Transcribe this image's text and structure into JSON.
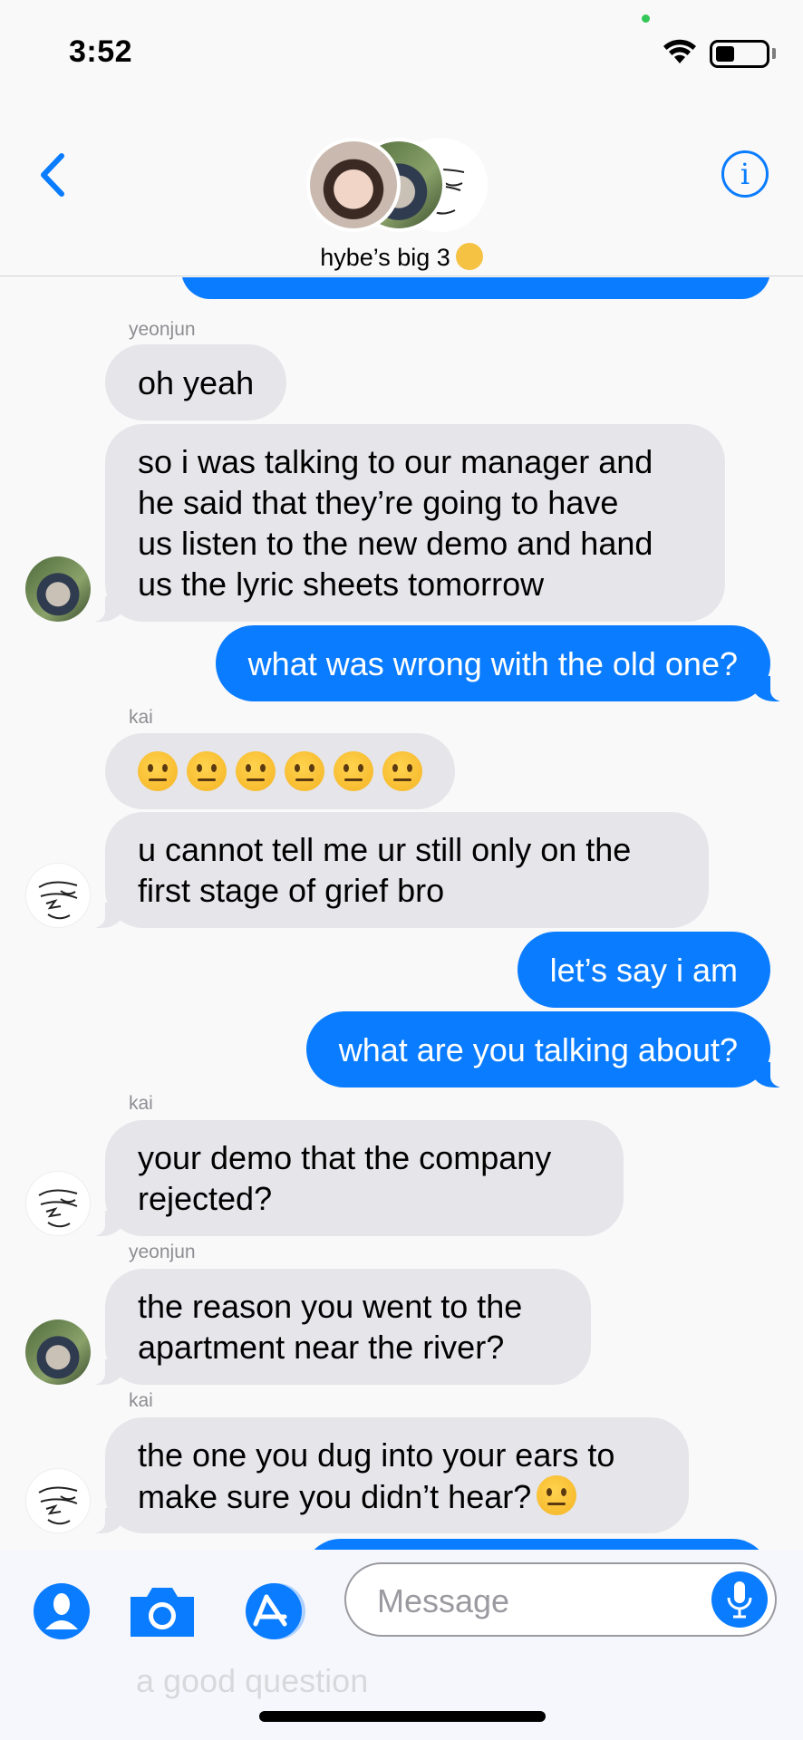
{
  "status_bar": {
    "time": "3:52"
  },
  "header": {
    "group_name": "hybe’s big 3",
    "group_emoji": "money-mouth-face"
  },
  "thread": {
    "partial_top": "",
    "messages": [
      {
        "id": "m1",
        "sender": "yeonjun",
        "text": "oh yeah"
      },
      {
        "id": "m2",
        "text": "so i was talking to our manager and\nhe said that they’re going to have\nus listen to the new demo and hand\nus the lyric sheets tomorrow"
      },
      {
        "id": "m3",
        "text": "what was wrong with the old one?"
      },
      {
        "id": "m4",
        "sender": "kai",
        "emoji": "neutral-face",
        "emoji_count": 6
      },
      {
        "id": "m5",
        "text": "u cannot tell me ur still only on the\nfirst stage of grief bro"
      },
      {
        "id": "m6",
        "text": "let’s say i am"
      },
      {
        "id": "m7",
        "text": "what are you talking about?"
      },
      {
        "id": "m8",
        "sender": "kai",
        "text": "your demo that the company\nrejected?"
      },
      {
        "id": "m9",
        "sender": "yeonjun",
        "text": "the reason you went to the\napartment near the river?"
      },
      {
        "id": "m10",
        "sender": "kai",
        "text": "the one you dug into your ears to\nmake sure you didn’t hear?",
        "trailing_emoji": "neutral-face"
      }
    ]
  },
  "composer": {
    "placeholder": "Message",
    "ghost_text": "a good question"
  },
  "colors": {
    "accent": "#0a7cff",
    "incoming": "#e5e5ea",
    "background": "#f9f9f9"
  }
}
